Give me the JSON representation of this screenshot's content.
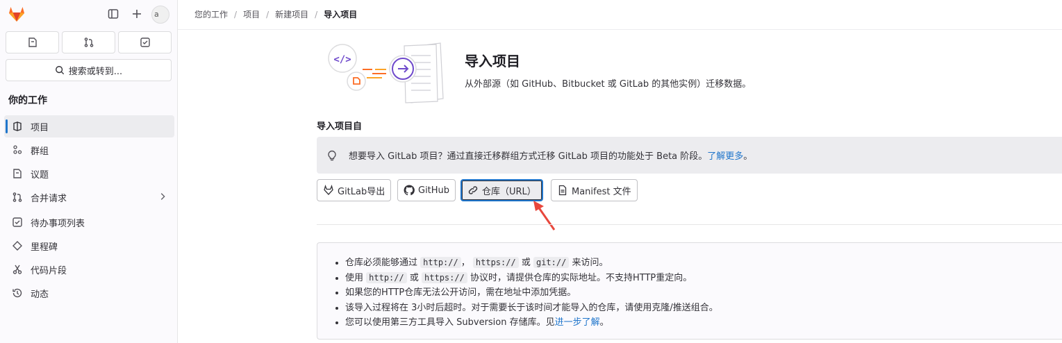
{
  "sidebar": {
    "avatar_text": "a",
    "search_label": "搜索或转到...",
    "section_title": "你的工作",
    "items": [
      {
        "label": "项目",
        "icon": "project-icon"
      },
      {
        "label": "群组",
        "icon": "group-icon"
      },
      {
        "label": "议题",
        "icon": "issues-icon"
      },
      {
        "label": "合并请求",
        "icon": "merge-request-icon"
      },
      {
        "label": "待办事项列表",
        "icon": "todo-icon"
      },
      {
        "label": "里程碑",
        "icon": "milestone-icon"
      },
      {
        "label": "代码片段",
        "icon": "snippet-icon"
      },
      {
        "label": "动态",
        "icon": "history-icon"
      }
    ]
  },
  "breadcrumb": [
    "您的工作",
    "项目",
    "新建项目",
    "导入项目"
  ],
  "header": {
    "title": "导入项目",
    "description": "从外部源（如 GitHub、Bitbucket 或 GitLab 的其他实例）迁移数据。"
  },
  "import_from_title": "导入项目自",
  "alert": {
    "text": "想要导入 GitLab 项目？通过直接迁移群组方式迁移 GitLab 项目的功能处于 Beta 阶段。",
    "link": "了解更多",
    "suffix": "。"
  },
  "import_buttons": [
    {
      "label": "GitLab导出",
      "icon": "tanuki-icon"
    },
    {
      "label": "GitHub",
      "icon": "github-icon"
    },
    {
      "label": "仓库（URL）",
      "icon": "link-icon",
      "selected": true
    },
    {
      "label": "Manifest 文件",
      "icon": "document-icon"
    }
  ],
  "info": {
    "line1": {
      "t1": "仓库必须能够通过",
      "c1": "http://",
      "t2": "，",
      "c2": "https://",
      "t3": "或",
      "c3": "git://",
      "t4": "来访问。"
    },
    "line2": {
      "t1": "使用",
      "c1": "http://",
      "t2": "或",
      "c2": "https://",
      "t3": "协议时，请提供仓库的实际地址。不支持HTTP重定向。"
    },
    "line3": "如果您的HTTP仓库无法公开访问，需在地址中添加凭据。",
    "line4": "该导入过程将在 3小时后超时。对于需要长于该时间才能导入的仓库，请使用克隆/推送组合。",
    "line5": {
      "t1": "您可以使用第三方工具导入 Subversion 存储库。见",
      "link": "进一步了解",
      "t2": "。"
    }
  },
  "colors": {
    "accent": "#1f75cb",
    "annotation_arrow": "#e8473c",
    "illustration_purple": "#6e49cb",
    "brand_orange": "#fc6d26"
  }
}
